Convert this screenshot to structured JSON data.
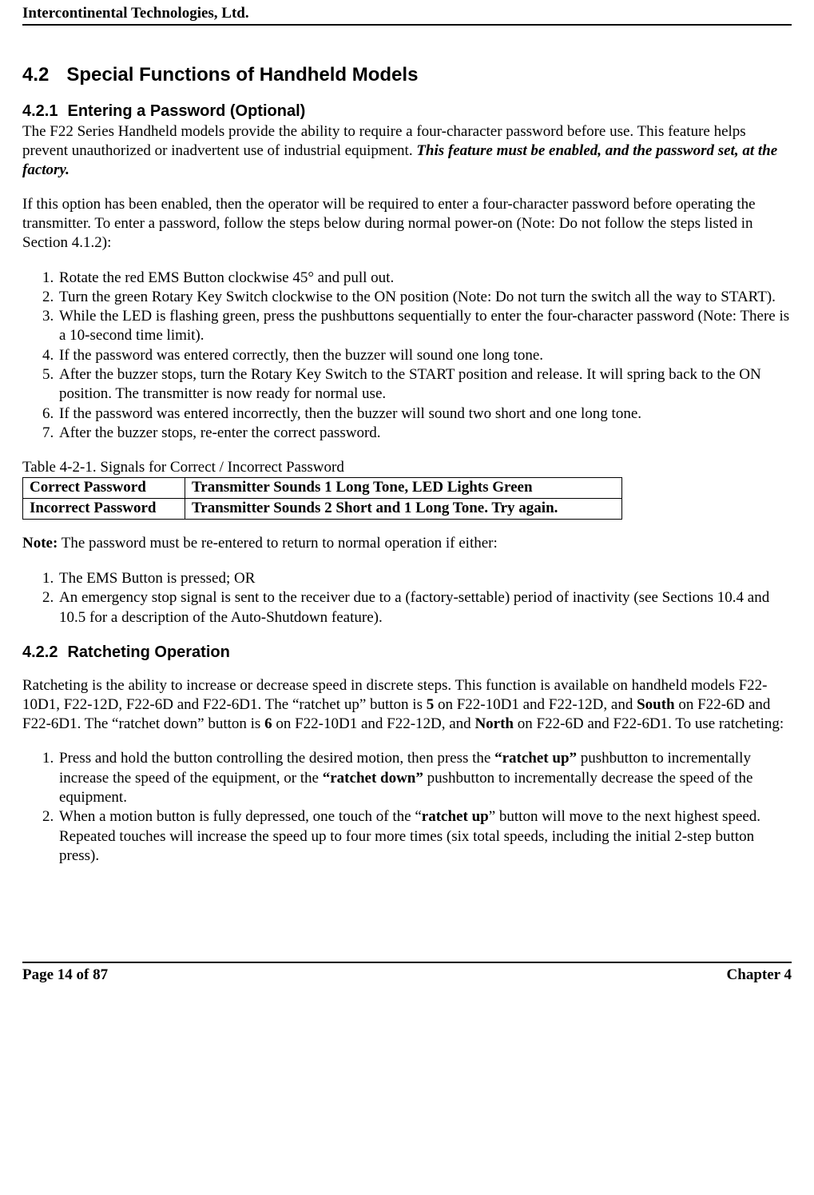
{
  "header": {
    "company": "Intercontinental Technologies, Ltd."
  },
  "section": {
    "number": "4.2",
    "title": "Special Functions of Handheld Models"
  },
  "sub1": {
    "number": "4.2.1",
    "title": "Entering a Password (Optional)",
    "para1_a": "The F22 Series Handheld models provide the ability to require a four-character password before use.  This feature helps prevent unauthorized or inadvertent use of industrial equipment.  ",
    "para1_b": "This feature must be enabled, and the password set, at the factory.",
    "para2": "If this option has been enabled, then the operator will be required to enter a four-character password before operating the transmitter.  To enter a password, follow the steps below during normal power-on (Note: Do not follow the steps listed in Section 4.1.2):",
    "steps": [
      "Rotate the red EMS Button clockwise 45° and pull out.",
      "Turn the green Rotary Key Switch clockwise to the ON position (Note:  Do not turn the switch all the way to START).",
      "While the LED is flashing green, press the pushbuttons sequentially to enter the four-character password (Note: There is a 10-second time limit).",
      "If the password was entered correctly, then the buzzer will sound one long tone.",
      "After the buzzer stops, turn the Rotary Key Switch to the START position and release. It will spring back to the ON position.  The transmitter is now ready for normal use.",
      "If the password  was entered incorrectly,  then the buzzer will sound two short and one long tone.",
      "After the buzzer stops, re-enter the correct password."
    ],
    "table_caption": "Table 4-2-1. Signals for Correct / Incorrect Password",
    "table": {
      "r1c1": "Correct Password",
      "r1c2": "Transmitter Sounds 1 Long Tone, LED Lights Green",
      "r2c1": "Incorrect Password",
      "r2c2": "Transmitter Sounds 2 Short and 1 Long Tone. Try again."
    },
    "note_label": "Note:",
    "note_text": " The password must be re-entered to return to normal operation if either:",
    "note_list": [
      "The EMS Button is pressed; OR",
      "An emergency stop signal is sent to the receiver due to a (factory-settable) period of inactivity (see Sections 10.4 and 10.5 for a description of the Auto-Shutdown feature)."
    ]
  },
  "sub2": {
    "number": "4.2.2",
    "title": "Ratcheting Operation",
    "para_parts": {
      "a": "Ratcheting is the ability to increase or decrease speed in discrete steps.  This function is available on handheld models F22-10D1, F22-12D, F22-6D and F22-6D1. The “ratchet up” button is ",
      "b5": "5",
      "c": " on F22-10D1 and F22-12D, and ",
      "bSouth": "South",
      "d": " on F22-6D and F22-6D1.  The “ratchet down” button is ",
      "b6": "6",
      "e": " on F22-10D1 and F22-12D, and ",
      "bNorth": "North",
      "f": " on F22-6D and F22-6D1.  To use ratcheting:"
    },
    "step1": {
      "a": "Press and hold the button controlling the desired motion, then press the ",
      "ru": "“ratchet up”",
      "b": " pushbutton to incrementally increase the speed of the equipment, or the ",
      "rd": "“ratchet down”",
      "c": " pushbutton to incrementally decrease the speed of the equipment."
    },
    "step2": {
      "a": "When a motion button is fully depressed, one touch of the “",
      "ru": "ratchet up",
      "b": "” button will move to the next highest speed.  Repeated touches will increase the speed up to four more times (six total speeds, including the initial 2-step button press)."
    }
  },
  "footer": {
    "left": "Page 14 of 87",
    "right": "Chapter 4"
  }
}
